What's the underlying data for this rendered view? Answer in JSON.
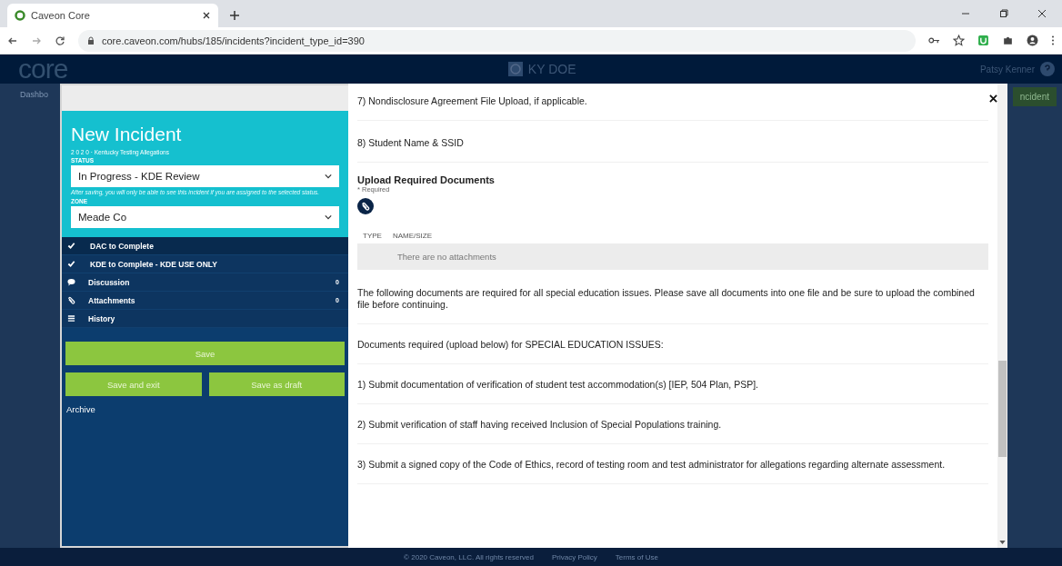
{
  "browser": {
    "tab_title": "Caveon Core",
    "url": "core.caveon.com/hubs/185/incidents?incident_type_id=390"
  },
  "header": {
    "logo": "core",
    "hub": "KY DOE",
    "user": "Patsy Kenner",
    "nav_left": "Dashbo",
    "nav_right": "ncident"
  },
  "sidebar": {
    "title": "New Incident",
    "subtitle": "2 0 2 0 · Kentucky Testing Allegations",
    "status_label": "STATUS",
    "status_value": "In Progress - KDE Review",
    "status_note": "After saving, you will only be able to see this incident if you are assigned to the selected status.",
    "zone_label": "ZONE",
    "zone_value": "Meade Co",
    "sections": [
      {
        "label": "DAC to Complete",
        "kind": "check",
        "selected": true
      },
      {
        "label": "KDE to Complete - KDE USE ONLY",
        "kind": "check",
        "selected": false
      },
      {
        "label": "Discussion",
        "kind": "chat",
        "count": "0",
        "selected": false
      },
      {
        "label": "Attachments",
        "kind": "clip",
        "count": "0",
        "selected": false
      },
      {
        "label": "History",
        "kind": "list",
        "selected": false
      }
    ],
    "buttons": [
      {
        "label": "Save",
        "kind": "wide"
      },
      {
        "label": "Save and exit",
        "kind": "half"
      },
      {
        "label": "Save as draft",
        "kind": "half"
      }
    ],
    "archive": "Archive"
  },
  "content": {
    "top_items": [
      "7) Nondisclosure Agreement File Upload, if applicable.",
      "8) Student Name & SSID"
    ],
    "upload": {
      "title": "Upload Required Documents",
      "required": "* Required",
      "columns": [
        "TYPE",
        "NAME/SIZE"
      ],
      "empty": "There are no attachments"
    },
    "paragraphs": [
      "The following documents are required for all special education issues. Please save all documents into one file and be sure to upload the combined file before continuing.",
      "Documents required (upload below) for SPECIAL EDUCATION ISSUES:",
      "1) Submit documentation of verification of student test accommodation(s) [IEP, 504 Plan, PSP].",
      "2) Submit verification of staff having received Inclusion of Special Populations training.",
      "3) Submit a signed copy of the Code of Ethics, record of testing room and test administrator for allegations regarding alternate assessment."
    ]
  },
  "footer": [
    "© 2020 Caveon, LLC. All rights reserved",
    "Privacy Policy",
    "Terms of Use"
  ]
}
